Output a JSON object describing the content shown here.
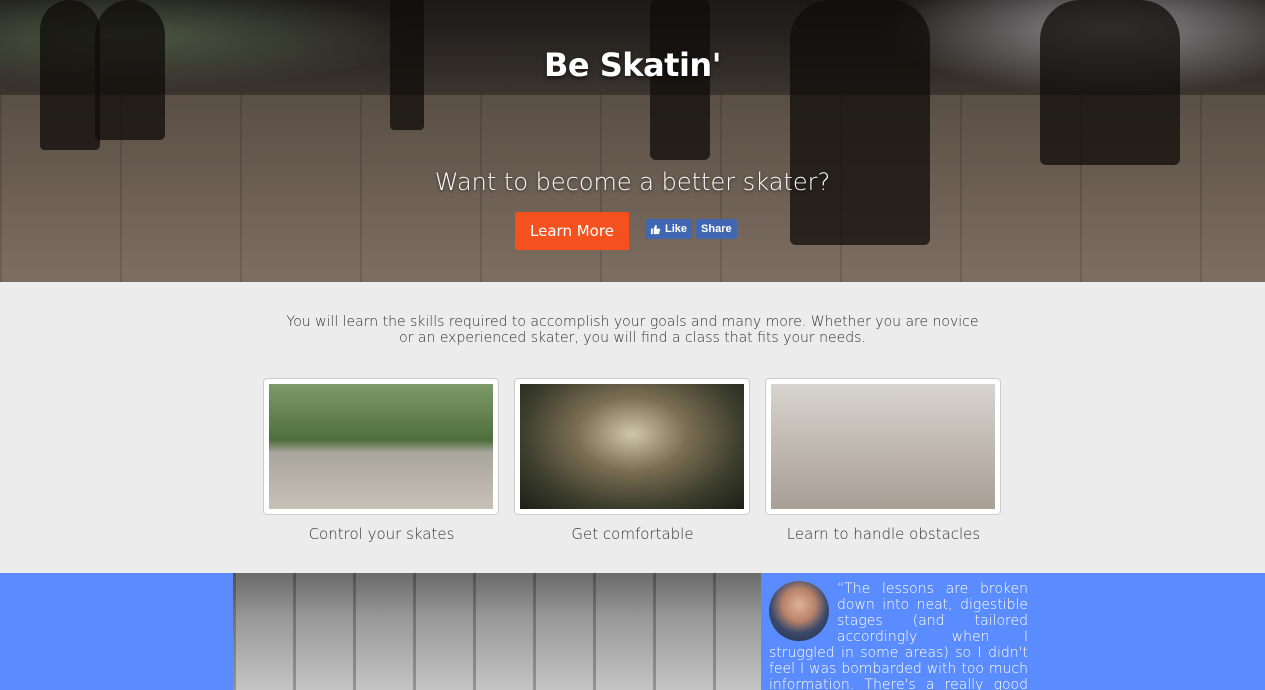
{
  "hero": {
    "title": "Be Skatin'",
    "subtitle": "Want to become a better skater?",
    "cta_label": "Learn More",
    "facebook": {
      "like_label": "Like",
      "share_label": "Share"
    }
  },
  "intro": {
    "text": "You will learn the skills required to accomplish your goals and many more. Whether you are novice or an experienced skater, you will find a class that fits your needs."
  },
  "cards": [
    {
      "caption": "Control your skates"
    },
    {
      "caption": "Get comfortable"
    },
    {
      "caption": "Learn to handle obstacles"
    }
  ],
  "testimonial": {
    "quote": "“The lessons are broken down into neat, digestible stages (and tailored accordingly when I struggled in some areas) so I didn't feel I was bombarded with too much information. There's a really good mix"
  },
  "colors": {
    "accent": "#f4511e",
    "facebook": "#4267b2",
    "testimonial_bg": "#5b8cff"
  }
}
